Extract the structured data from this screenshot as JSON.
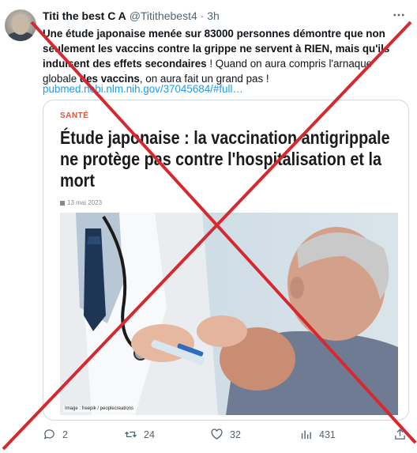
{
  "tweet": {
    "author_name": "Titi the best C A",
    "handle": "@Titithebest4",
    "separator": "·",
    "time": "3h",
    "text_part1": "Une étude japonaise menée sur 83000 personnes démontre que non seulement les vaccins contre la grippe ne servent à RIEN, mais qu'ils induisent des effets secondaires",
    "text_part2": " ! Quand on aura compris l'arnaque globale ",
    "text_part3": "des vaccins",
    "text_part4": ", on aura fait un grand pas !",
    "link": "pubmed.ncbi.nlm.nih.gov/37045684/#full…"
  },
  "card": {
    "category": "SANTÉ",
    "headline": "Étude japonaise : la vaccination antigrippale ne protège pas contre l'hospitalisation et la mort",
    "date": "13 mai 2023",
    "image_credit": "Image : freepik / peoplecreations"
  },
  "actions": {
    "replies": "2",
    "retweets": "24",
    "likes": "32",
    "views": "431"
  },
  "colors": {
    "x_mark": "#d6282e",
    "link": "#1d9bf0",
    "category": "#d6573c"
  },
  "icons": [
    "more-icon",
    "reply-icon",
    "retweet-icon",
    "like-icon",
    "views-icon",
    "share-icon",
    "calendar-icon"
  ]
}
